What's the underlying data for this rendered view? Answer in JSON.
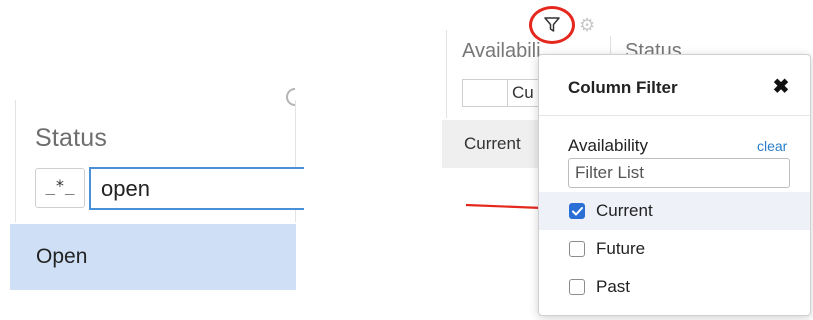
{
  "left_panel": {
    "column_title": "Status",
    "mode_symbol": "_*_",
    "filter_value": "open",
    "suggestion": "Open",
    "icons": {
      "partial": "partial-circle-icon"
    }
  },
  "grid": {
    "headers": {
      "availability": "Availabili",
      "status": "Status"
    },
    "filter_input": "Cu",
    "row": {
      "availability": "Current"
    },
    "icons": {
      "filter": "filter-icon",
      "settings": "gear-icon"
    }
  },
  "popup": {
    "title": "Column Filter",
    "close_icon": "close-icon",
    "label": "Availability",
    "clear": "clear",
    "search_placeholder": "Filter List",
    "options": [
      {
        "label": "Current",
        "checked": true
      },
      {
        "label": "Future",
        "checked": false
      },
      {
        "label": "Past",
        "checked": false
      }
    ]
  },
  "colors": {
    "accent": "#2a6fd6",
    "highlight_red": "#e5281e",
    "suggestion_bg": "#cfe0f6",
    "input_border": "#4a90d9"
  }
}
